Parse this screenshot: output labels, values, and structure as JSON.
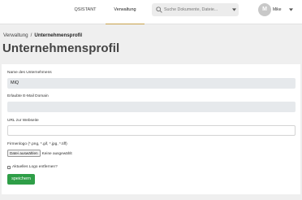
{
  "topbar": {
    "nav": [
      {
        "label": "QSISTANT"
      },
      {
        "label": "Verwaltung"
      }
    ],
    "search": {
      "placeholder": "Suche Dokumente, Dateie..."
    },
    "user": {
      "initial": "M",
      "name": "Mike"
    }
  },
  "breadcrumb": {
    "parent": "Verwaltung",
    "separator": "/",
    "current": "Unternehmensprofil"
  },
  "page": {
    "title": "Unternehmensprofil"
  },
  "form": {
    "company_name": {
      "label": "Name des Unternehmens",
      "value": "MiQ"
    },
    "email_domain": {
      "label": "Erlaubte E-Mail Domain",
      "value": ""
    },
    "website": {
      "label": "URL zur Webseite",
      "value": ""
    },
    "logo": {
      "label": "Firmenlogo (*.png, *.gif, *.jpg, *.tiff)",
      "button": "Datei auswählen",
      "status": "Keine ausgewählt"
    },
    "remove_logo": {
      "label": "Aktuelles Logo entfernen?"
    },
    "save": {
      "label": "speichern"
    }
  },
  "colors": {
    "accent": "#c9a24a",
    "save_button": "#2e9e47",
    "disabled_field": "#e6e9ec"
  },
  "icons": {
    "search": "search-icon",
    "dropdown": "chevron-down-icon",
    "user": "avatar"
  }
}
